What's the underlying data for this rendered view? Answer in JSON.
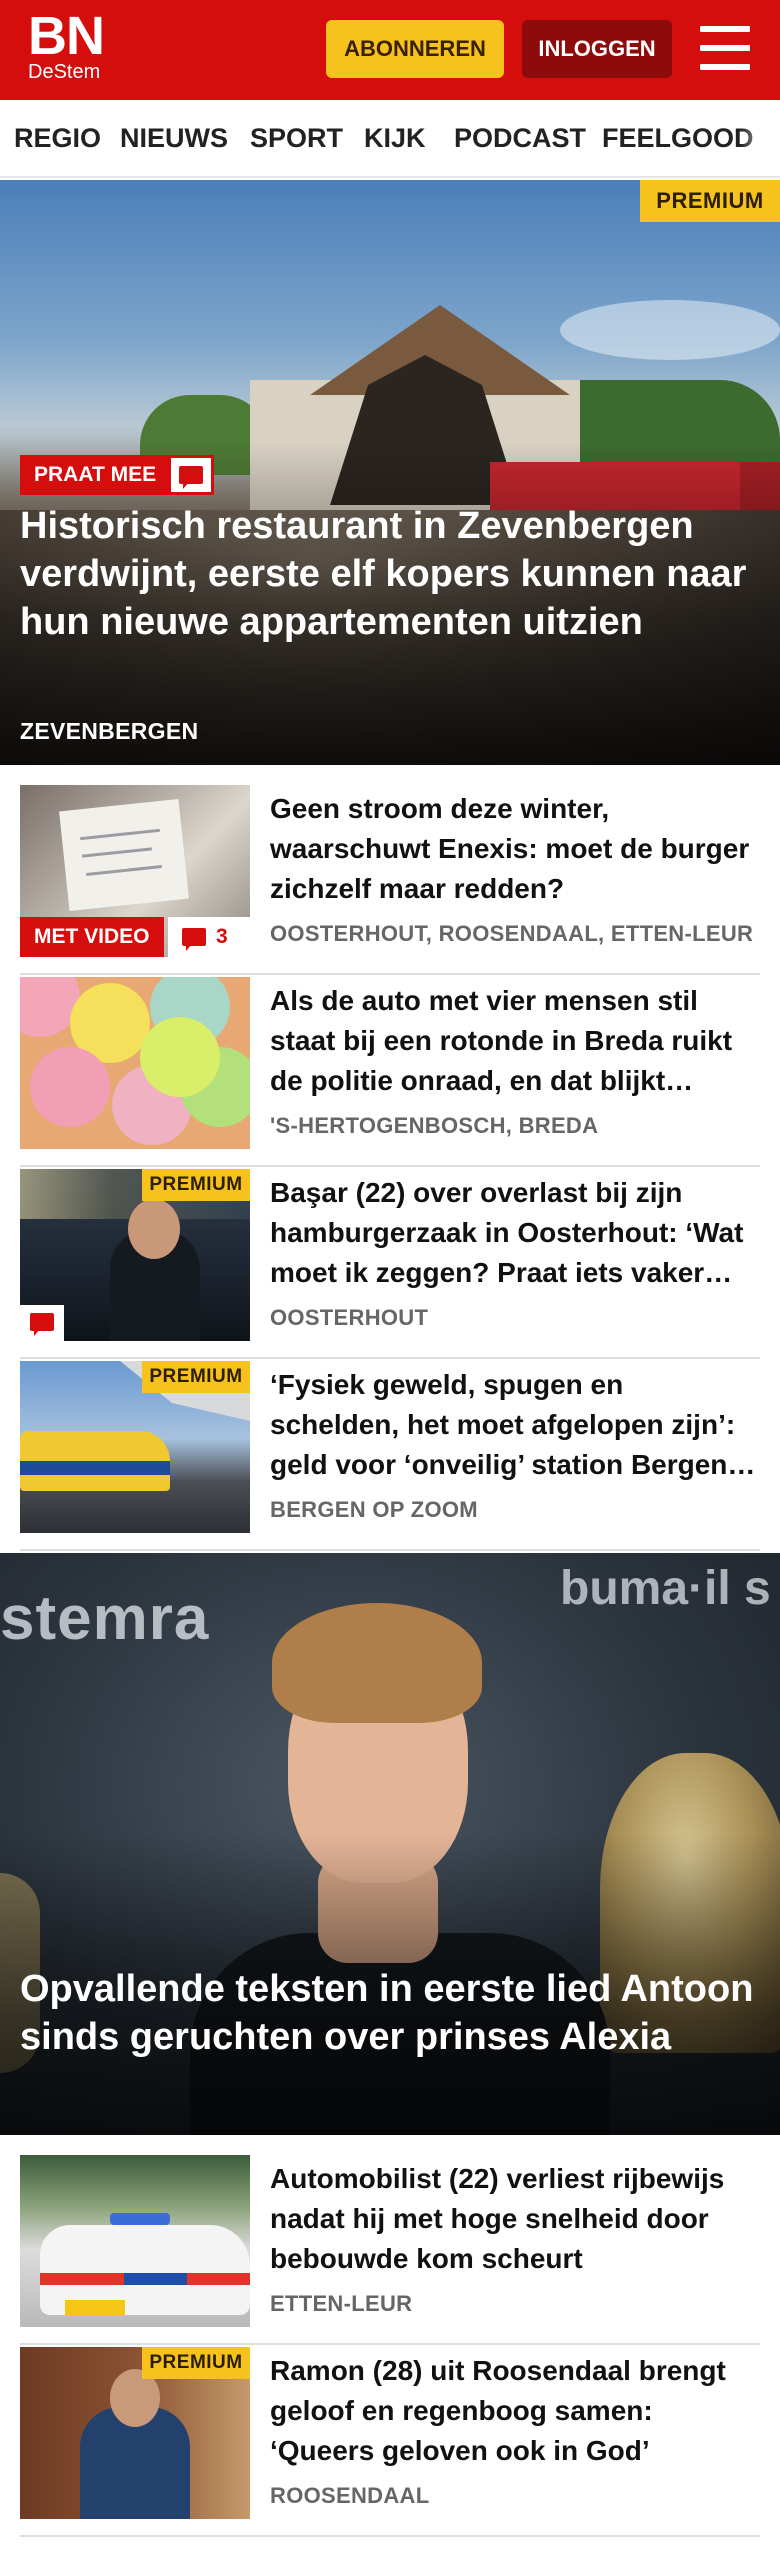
{
  "header": {
    "logo_main": "BN",
    "logo_sub": "DeStem",
    "subscribe_label": "ABONNEREN",
    "login_label": "INLOGGEN",
    "menu_icon": "hamburger-menu-icon",
    "brand_color": "#d50d0d",
    "subscribe_color": "#f7c21d"
  },
  "nav": {
    "items": [
      "REGIO",
      "NIEUWS",
      "SPORT",
      "KIJK",
      "PODCAST",
      "FEELGOOD"
    ]
  },
  "hero": {
    "badge": "PREMIUM",
    "tag": "PRAAT MEE",
    "tag_icon": "comment-bubble-icon",
    "title": "Historisch restaurant in Zevenbergen verdwijnt, eerste elf kopers kunnen naar hun nieuwe appartementen uitzien",
    "location": "ZEVENBERGEN"
  },
  "articles": [
    {
      "title": "Geen stroom deze winter, waarschuwt Enexis: moet de burger zichzelf maar redden?",
      "location": "OOSTERHOUT, ROOSENDAAL, ETTEN-LEUR",
      "video_label": "MET VIDEO",
      "comment_count": "3"
    },
    {
      "title": "Als de auto met vier mensen stil staat bij een rotonde in Breda ruikt de politie onraad, en dat blijkt terecht",
      "location": "'S-HERTOGENBOSCH, BREDA"
    },
    {
      "title": "Başar (22) over overlast bij zijn hamburgerzaak in Oosterhout: ‘Wat moet ik zeggen? Praat iets vaker met elkaar’",
      "location": "OOSTERHOUT",
      "badge": "PREMIUM"
    },
    {
      "title": "‘Fysiek geweld, spugen en schelden, het moet afgelopen zijn’: geld voor ‘onveilig’ station Bergen op Zoom",
      "location": "BERGEN OP ZOOM",
      "badge": "PREMIUM"
    }
  ],
  "feature": {
    "logo_left": "stemra",
    "logo_right": "buma·il s",
    "title": "Opvallende teksten in eerste lied Antoon sinds geruchten over prinses Alexia"
  },
  "articles2": [
    {
      "title": "Automobilist (22) verliest rijbewijs nadat hij met hoge snelheid door bebouwde kom scheurt",
      "location": "ETTEN-LEUR"
    },
    {
      "title": "Ramon (28) uit Roosendaal brengt geloof en regenboog samen: ‘Queers geloven ook in God’",
      "location": "ROOSENDAAL",
      "badge": "PREMIUM"
    }
  ]
}
